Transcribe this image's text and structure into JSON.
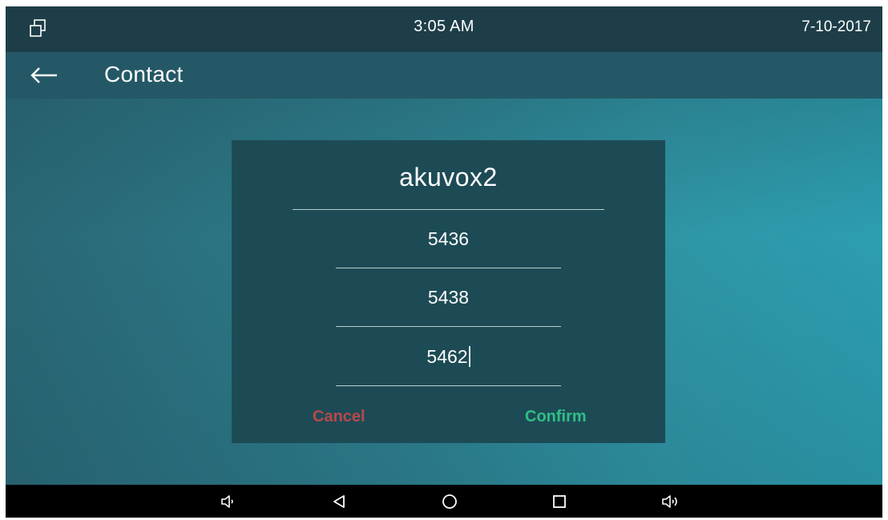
{
  "status_bar": {
    "time": "3:05 AM",
    "date": "7-10-2017",
    "icon": "multi-window-icon"
  },
  "title_bar": {
    "back_icon": "back-arrow-icon",
    "title": "Contact"
  },
  "dialog": {
    "name": "akuvox2",
    "numbers": [
      "5436",
      "5438",
      "5462"
    ],
    "cancel_label": "Cancel",
    "confirm_label": "Confirm"
  },
  "nav_bar": {
    "buttons": [
      "volume-down-icon",
      "back-triangle-icon",
      "home-circle-icon",
      "recents-square-icon",
      "volume-up-icon"
    ]
  },
  "colors": {
    "status_bar_bg": "#1d3e48",
    "title_bar_bg": "#245866",
    "dialog_bg": "#1d4b55",
    "cancel": "#b8484c",
    "confirm": "#2fbf86"
  }
}
